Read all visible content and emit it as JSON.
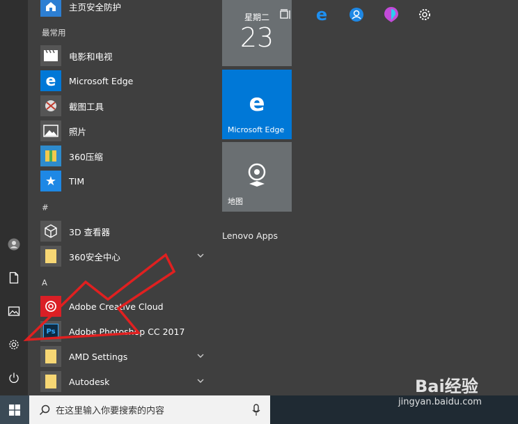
{
  "app_list": {
    "top_item": "主页安全防护",
    "frequent_header": "最常用",
    "frequent": [
      "电影和电视",
      "Microsoft Edge",
      "截图工具",
      "照片",
      "360压缩",
      "TIM"
    ],
    "hash_header": "#",
    "hash_items": [
      "3D 查看器",
      "360安全中心"
    ],
    "a_header": "A",
    "a_items": [
      "Adobe Creative Cloud",
      "Adobe Photoshop CC 2017",
      "AMD Settings",
      "Autodesk"
    ]
  },
  "tiles": {
    "calendar": {
      "weekday": "星期二",
      "day": "23"
    },
    "edge_label": "Microsoft Edge",
    "maps_label": "地图",
    "group_label": "Lenovo Apps"
  },
  "taskbar": {
    "search_placeholder": "在这里输入你要搜索的内容"
  },
  "watermark": {
    "text": "Bai经验",
    "url": "jingyan.baidu.com"
  },
  "colors": {
    "accent": "#0078d7",
    "menu_bg": "#3f3f3f",
    "tile_gray": "#6a6f72",
    "taskbar": "#1f2a33",
    "arrow_red": "#e02020"
  }
}
